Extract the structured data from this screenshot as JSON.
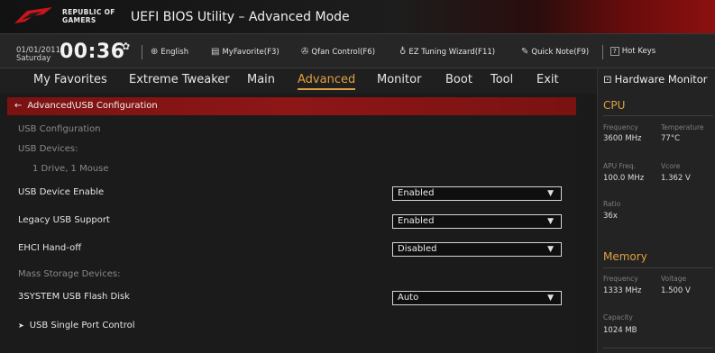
{
  "header": {
    "brand_line1": "REPUBLIC OF",
    "brand_line2": "GAMERS",
    "title": "UEFI BIOS Utility – Advanced Mode"
  },
  "toolbar": {
    "date": "01/01/2011",
    "day": "Saturday",
    "time": "00:36",
    "language": "English",
    "myfavorite": "MyFavorite(F3)",
    "qfan": "Qfan Control(F6)",
    "ez_tuning": "EZ Tuning Wizard(F11)",
    "quick_note": "Quick Note(F9)",
    "hotkeys_key": "?",
    "hotkeys": "Hot Keys"
  },
  "nav": {
    "tabs": [
      "My Favorites",
      "Extreme Tweaker",
      "Main",
      "Advanced",
      "Monitor",
      "Boot",
      "Tool",
      "Exit"
    ],
    "active": "Advanced"
  },
  "breadcrumb": "Advanced\\USB Configuration",
  "main": {
    "usb_configuration": "USB Configuration",
    "usb_devices": "USB Devices:",
    "device_summary": "1 Drive, 1 Mouse",
    "usb_device_enable": {
      "label": "USB Device Enable",
      "value": "Enabled"
    },
    "legacy_usb_support": {
      "label": "Legacy USB Support",
      "value": "Enabled"
    },
    "ehci_handoff": {
      "label": "EHCI Hand-off",
      "value": "Disabled"
    },
    "mass_storage_devices": "Mass Storage Devices:",
    "flash_disk": {
      "label": "3SYSTEM USB Flash Disk",
      "value": "Auto"
    },
    "usb_single_port": "USB Single Port Control"
  },
  "hardware_monitor": {
    "title": "Hardware Monitor",
    "cpu": {
      "heading": "CPU",
      "frequency_label": "Frequency",
      "frequency": "3600 MHz",
      "temperature_label": "Temperature",
      "temperature": "77°C",
      "apu_freq_label": "APU Freq.",
      "apu_freq": "100.0 MHz",
      "vcore_label": "Vcore",
      "vcore": "1.362 V",
      "ratio_label": "Ratio",
      "ratio": "36x"
    },
    "memory": {
      "heading": "Memory",
      "frequency_label": "Frequency",
      "frequency": "1333 MHz",
      "voltage_label": "Voltage",
      "voltage": "1.500 V",
      "capacity_label": "Capacity",
      "capacity": "1024 MB"
    }
  },
  "colors": {
    "accent": "#e0a040",
    "breadcrumb_red": "#8e1616",
    "background": "#1a1a1a"
  },
  "icons": [
    "rog-logo-icon",
    "gear-icon",
    "globe-icon",
    "favorite-icon",
    "fan-icon",
    "bulb-icon",
    "note-icon",
    "help-icon",
    "monitor-icon",
    "back-arrow-icon",
    "chevron-right-icon",
    "dropdown-arrow-icon"
  ]
}
